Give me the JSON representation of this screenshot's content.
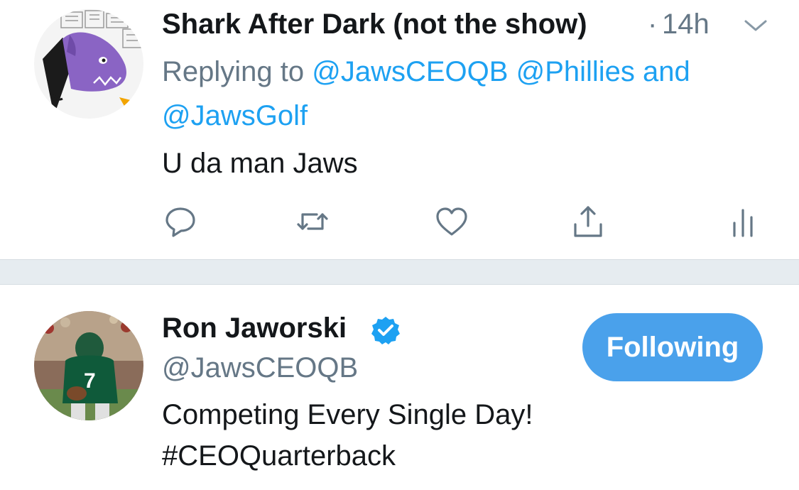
{
  "reply_tweet": {
    "display_name": "Shark After Dark (not the show)",
    "separator": "·",
    "time": "14h",
    "replying_prefix": "Replying to",
    "mention_1": "@JawsCEOQB",
    "mention_2": "@Phillies",
    "mention_joiner": "and",
    "mention_3": "@JawsGolf",
    "text": "U da man Jaws",
    "actions": [
      "reply-icon",
      "retweet-icon",
      "like-icon",
      "share-icon",
      "analytics-icon"
    ]
  },
  "profile": {
    "display_name": "Ron Jaworski",
    "handle": "@JawsCEOQB",
    "verified": true,
    "follow_button": "Following",
    "bio_line_1": "Competing Every Single Day!",
    "bio_line_2": "#CEOQuarterback"
  },
  "colors": {
    "accent": "#1da1f2",
    "button": "#4aa1eb",
    "secondary_text": "#657786",
    "divider": "#e6ecf0"
  }
}
